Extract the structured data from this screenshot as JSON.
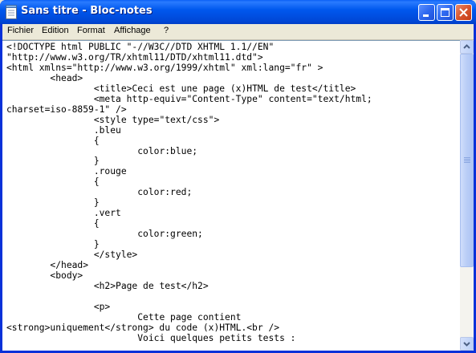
{
  "window": {
    "title": "Sans titre - Bloc-notes",
    "app_icon": "notepad-icon",
    "controls": [
      "minimize-icon",
      "maximize-icon",
      "close-icon"
    ]
  },
  "menu": {
    "items": [
      {
        "label": "Fichier"
      },
      {
        "label": "Edition"
      },
      {
        "label": "Format"
      },
      {
        "label": "Affichage"
      },
      {
        "label": "?"
      }
    ]
  },
  "editor": {
    "content": "<!DOCTYPE html PUBLIC \"-//W3C//DTD XHTML 1.1//EN\"\n\"http://www.w3.org/TR/xhtml11/DTD/xhtml11.dtd\">\n<html xmlns=\"http://www.w3.org/1999/xhtml\" xml:lang=\"fr\" >\n\t<head>\n\t\t<title>Ceci est une page (x)HTML de test</title>\n\t\t<meta http-equiv=\"Content-Type\" content=\"text/html;\ncharset=iso-8859-1\" />\n\t\t<style type=\"text/css\">\n\t\t.bleu\n\t\t{\n\t\t\tcolor:blue;\n\t\t}\n\t\t.rouge\n\t\t{\n\t\t\tcolor:red;\n\t\t}\n\t\t.vert\n\t\t{\n\t\t\tcolor:green;\n\t\t}\n\t\t</style>\n\t</head>\n\t<body>\n\t\t<h2>Page de test</h2>\n\n\t\t<p>\n\t\t\tCette page contient\n<strong>uniquement</strong> du code (x)HTML.<br />\n\t\t\tVoici quelques petits tests :"
  },
  "colors": {
    "titlebar": "#0058EE",
    "frame": "#0831D9",
    "menubar": "#ECE9D8",
    "close_button": "#D8552E"
  }
}
